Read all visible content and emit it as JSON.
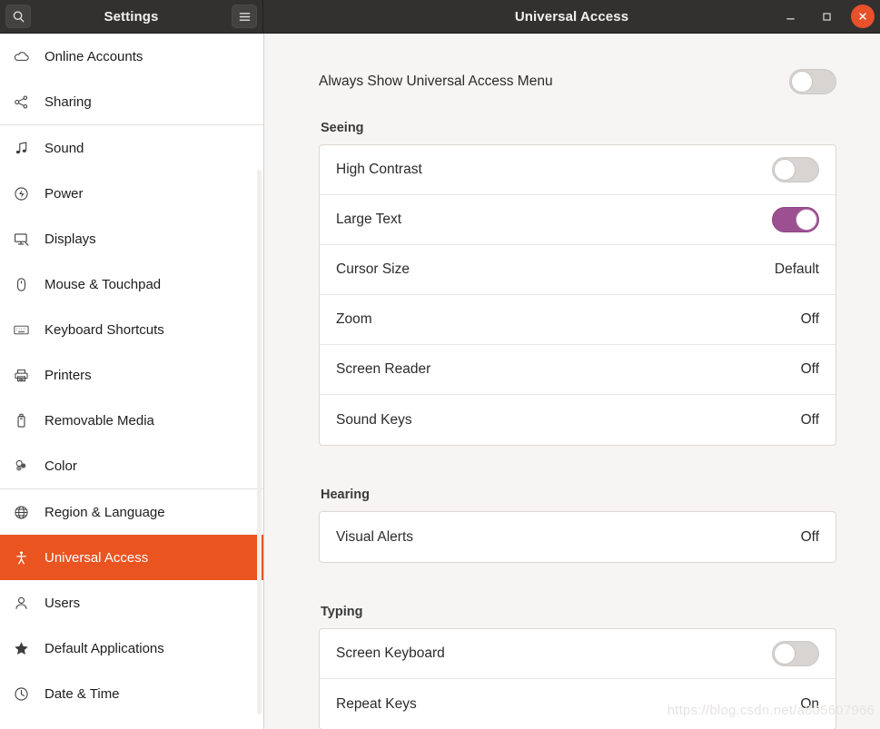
{
  "window": {
    "sidebar_title": "Settings",
    "content_title": "Universal Access",
    "search_icon": "search-icon",
    "menu_icon": "hamburger-menu-icon",
    "minimize_label": "–",
    "maximize_label": "□",
    "close_label": "✕",
    "accent_color": "#e95420",
    "close_color": "#e8512a",
    "titlebar_color": "#333130"
  },
  "sidebar": {
    "items": [
      {
        "label": "Online Accounts",
        "icon": "cloud-icon",
        "selected": false,
        "divider_after": false
      },
      {
        "label": "Sharing",
        "icon": "share-nodes-icon",
        "selected": false,
        "divider_after": true
      },
      {
        "label": "Sound",
        "icon": "music-note-icon",
        "selected": false,
        "divider_after": false
      },
      {
        "label": "Power",
        "icon": "power-icon",
        "selected": false,
        "divider_after": false
      },
      {
        "label": "Displays",
        "icon": "monitor-icon",
        "selected": false,
        "divider_after": false
      },
      {
        "label": "Mouse & Touchpad",
        "icon": "mouse-icon",
        "selected": false,
        "divider_after": false
      },
      {
        "label": "Keyboard Shortcuts",
        "icon": "keyboard-icon",
        "selected": false,
        "divider_after": false
      },
      {
        "label": "Printers",
        "icon": "printer-icon",
        "selected": false,
        "divider_after": false
      },
      {
        "label": "Removable Media",
        "icon": "usb-drive-icon",
        "selected": false,
        "divider_after": false
      },
      {
        "label": "Color",
        "icon": "color-palette-icon",
        "selected": false,
        "divider_after": true
      },
      {
        "label": "Region & Language",
        "icon": "globe-icon",
        "selected": false,
        "divider_after": false
      },
      {
        "label": "Universal Access",
        "icon": "accessibility-person-icon",
        "selected": true,
        "divider_after": false
      },
      {
        "label": "Users",
        "icon": "user-icon",
        "selected": false,
        "divider_after": false
      },
      {
        "label": "Default Applications",
        "icon": "star-icon",
        "selected": false,
        "divider_after": false
      },
      {
        "label": "Date & Time",
        "icon": "clock-icon",
        "selected": false,
        "divider_after": false
      }
    ]
  },
  "main": {
    "always_show_menu": {
      "label": "Always Show Universal Access Menu",
      "toggle_state": "off"
    },
    "sections": [
      {
        "title": "Seeing",
        "rows": [
          {
            "label": "High Contrast",
            "control": "toggle",
            "state": "off"
          },
          {
            "label": "Large Text",
            "control": "toggle",
            "state": "on"
          },
          {
            "label": "Cursor Size",
            "control": "value",
            "value": "Default"
          },
          {
            "label": "Zoom",
            "control": "value",
            "value": "Off"
          },
          {
            "label": "Screen Reader",
            "control": "value",
            "value": "Off"
          },
          {
            "label": "Sound Keys",
            "control": "value",
            "value": "Off"
          }
        ]
      },
      {
        "title": "Hearing",
        "rows": [
          {
            "label": "Visual Alerts",
            "control": "value",
            "value": "Off"
          }
        ]
      },
      {
        "title": "Typing",
        "rows": [
          {
            "label": "Screen Keyboard",
            "control": "toggle",
            "state": "off"
          },
          {
            "label": "Repeat Keys",
            "control": "value",
            "value": "On"
          }
        ]
      }
    ]
  },
  "watermark": {
    "text": "https://blog.csdn.net/a805607966"
  }
}
